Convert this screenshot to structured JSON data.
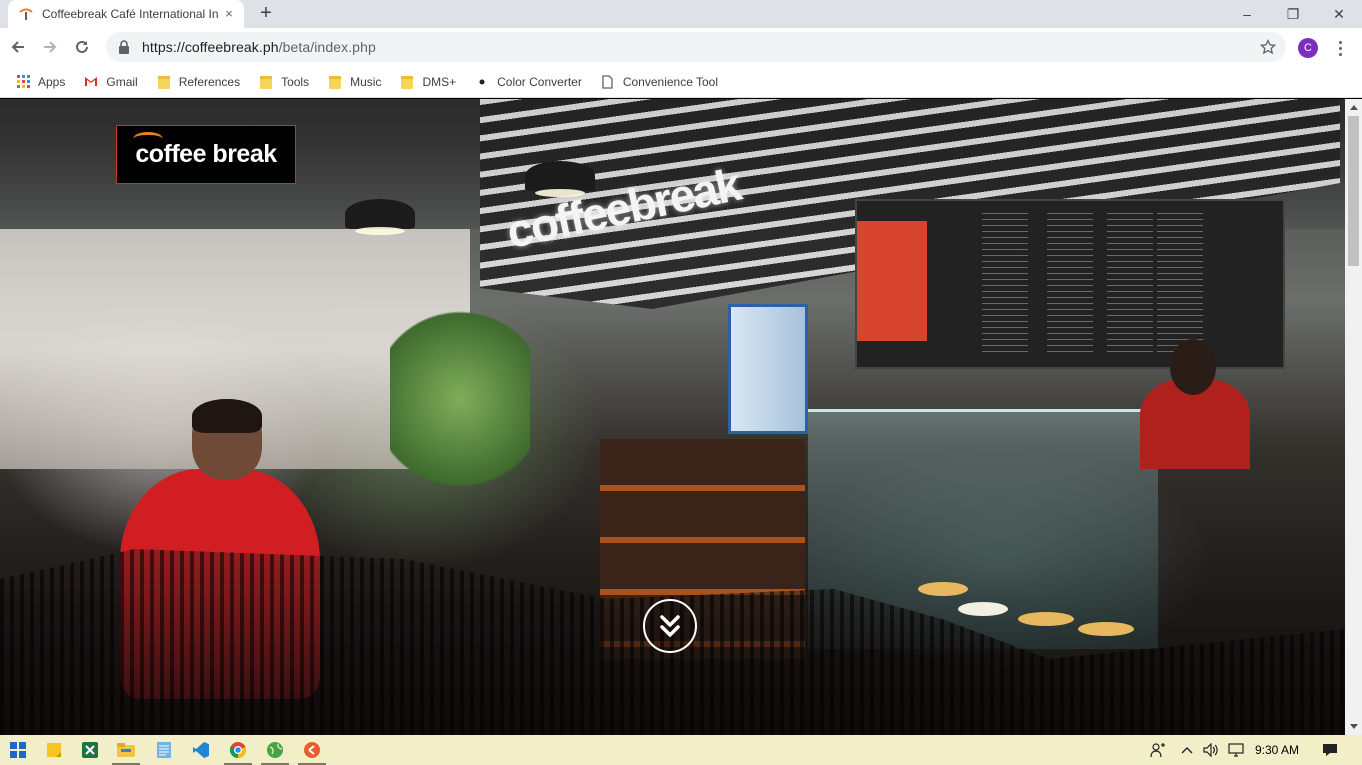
{
  "browser": {
    "tab": {
      "title": "Coffeebreak Café International In",
      "close_glyph": "×"
    },
    "new_tab_glyph": "+",
    "window_controls": {
      "minimize": "–",
      "restore": "❐",
      "close": "✕"
    },
    "url": {
      "host": "https://coffeebreak.ph",
      "path": "/beta/index.php"
    },
    "profile_initial": "C",
    "bookmarks": [
      {
        "label": "Apps",
        "icon": "apps-grid-icon"
      },
      {
        "label": "Gmail",
        "icon": "gmail-icon"
      },
      {
        "label": "References",
        "icon": "folder-icon"
      },
      {
        "label": "Tools",
        "icon": "folder-icon"
      },
      {
        "label": "Music",
        "icon": "folder-icon"
      },
      {
        "label": "DMS+",
        "icon": "folder-icon"
      },
      {
        "label": "Color Converter",
        "icon": "dot-icon"
      },
      {
        "label": "Convenience Tool",
        "icon": "page-icon"
      }
    ]
  },
  "page": {
    "logo_text": "coffee break",
    "sign_text": "coffeebreak",
    "scroll_down": "scroll-down-icon"
  },
  "taskbar": {
    "apps": [
      "start-icon",
      "sticky-notes-icon",
      "excel-icon",
      "file-explorer-icon",
      "notepad-icon",
      "vscode-icon",
      "chrome-icon",
      "globe-icon",
      "media-icon"
    ],
    "clock": "9:30 AM"
  },
  "colors": {
    "accent_orange": "#e8821e",
    "logo_border": "#c0392b",
    "profile": "#7b2fbf",
    "taskbar": "#f2eec7"
  }
}
